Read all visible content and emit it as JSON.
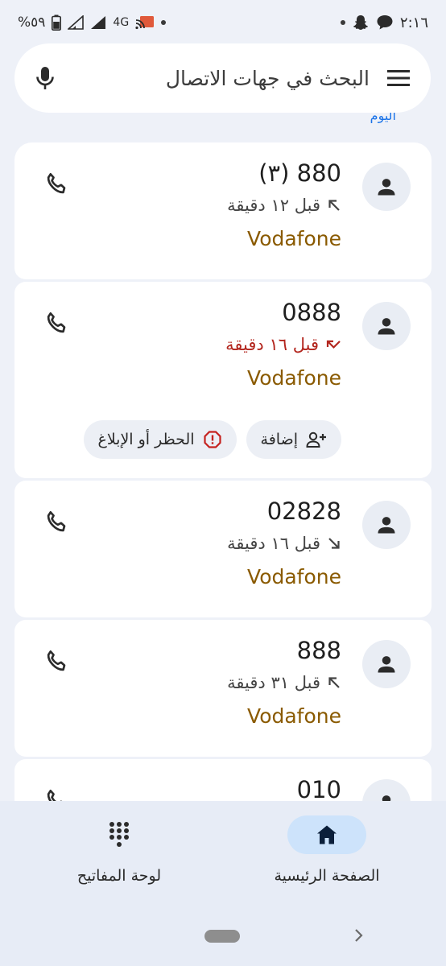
{
  "status_bar": {
    "time": "٢:١٦",
    "battery": "%٥٩",
    "network": "4G"
  },
  "search": {
    "placeholder": "البحث في جهات الاتصال"
  },
  "section_label": "اليوم",
  "calls": [
    {
      "number": "880 (٣)",
      "direction": "outgoing",
      "time": "قبل ١٢ دقيقة",
      "carrier": "Vodafone"
    },
    {
      "number": "0888",
      "direction": "missed",
      "time": "قبل ١٦ دقيقة",
      "carrier": "Vodafone",
      "actions": {
        "add": "إضافة",
        "block": "الحظر أو الإبلاغ"
      }
    },
    {
      "number": "02828",
      "direction": "incoming",
      "time": "قبل ١٦ دقيقة",
      "carrier": "Vodafone"
    },
    {
      "number": "888",
      "direction": "outgoing",
      "time": "قبل ٣١ دقيقة",
      "carrier": "Vodafone"
    },
    {
      "number": "010"
    }
  ],
  "bottom_nav": {
    "home": "الصفحة الرئيسية",
    "keypad": "لوحة المفاتيح"
  },
  "colors": {
    "missed": "#b3261e",
    "carrier": "#8a5a00",
    "selected_pill": "#cde3fb"
  }
}
